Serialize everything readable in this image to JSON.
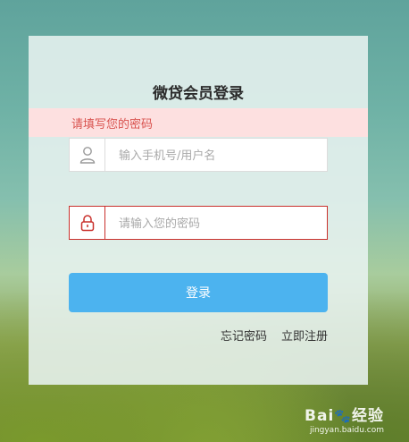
{
  "login": {
    "title": "微贷会员登录",
    "error_message": "请填写您的密码",
    "username": {
      "placeholder": "输入手机号/用户名",
      "value": ""
    },
    "password": {
      "placeholder": "请输入您的密码",
      "value": ""
    },
    "login_button": "登录",
    "forgot_password": "忘记密码",
    "register": "立即注册"
  },
  "watermark": {
    "brand_a": "Bai",
    "brand_b": "经验",
    "url": "jingyan.baidu.com"
  },
  "colors": {
    "accent": "#4cb3ef",
    "error": "#d9534f",
    "error_bg": "#fde0e0",
    "error_border": "#c9302c"
  },
  "icons": {
    "username": "user-icon",
    "password": "lock-icon"
  }
}
